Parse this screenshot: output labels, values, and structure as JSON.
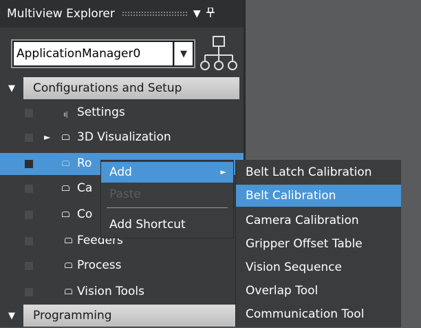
{
  "window": {
    "title": "Multiview Explorer",
    "dropdown_glyph": "▼",
    "pin_glyph": "ㅁ"
  },
  "selector": {
    "value": "ApplicationManager0",
    "arrow": "▼"
  },
  "tree": {
    "groups": [
      {
        "label": "Configurations and Setup",
        "expander": "▼"
      },
      {
        "label": "Programming",
        "expander": "▼"
      }
    ],
    "items": [
      {
        "label": "Settings"
      },
      {
        "label": "3D Visualization",
        "expander": "►"
      },
      {
        "label": "Ro"
      },
      {
        "label": "Ca"
      },
      {
        "label": "Co"
      },
      {
        "label": "Feeders"
      },
      {
        "label": "Process"
      },
      {
        "label": "Vision Tools"
      }
    ]
  },
  "context_menu": {
    "items": [
      {
        "label": "Add",
        "arrow": "►"
      },
      {
        "label": "Paste"
      },
      {
        "label": "Add Shortcut"
      }
    ]
  },
  "submenu": {
    "items": [
      {
        "label": "Belt Latch Calibration"
      },
      {
        "label": "Belt Calibration"
      },
      {
        "label": "Camera Calibration"
      },
      {
        "label": "Gripper Offset Table"
      },
      {
        "label": "Vision Sequence"
      },
      {
        "label": "Overlap Tool"
      },
      {
        "label": "Communication Tool"
      }
    ]
  },
  "colors": {
    "selection": "#4a95d6",
    "panel": "#3a3b3d",
    "workspace": "#5a5b5d"
  }
}
